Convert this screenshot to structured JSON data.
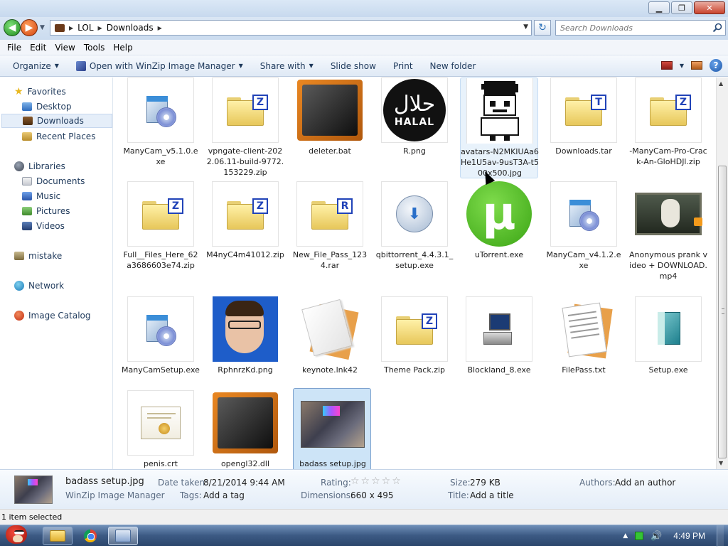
{
  "window": {
    "controls": {
      "minimize": "▁",
      "maximize": "❐",
      "close": "✕"
    }
  },
  "address": {
    "crumbs": [
      "LOL",
      "Downloads"
    ],
    "search_placeholder": "Search Downloads"
  },
  "menu": [
    "File",
    "Edit",
    "View",
    "Tools",
    "Help"
  ],
  "commands": {
    "organize": "Organize",
    "open_with": "Open with WinZip Image Manager",
    "share_with": "Share with",
    "slide_show": "Slide show",
    "print": "Print",
    "new_folder": "New folder",
    "help": "?"
  },
  "nav": {
    "favorites": "Favorites",
    "desktop": "Desktop",
    "downloads": "Downloads",
    "recent": "Recent Places",
    "libraries": "Libraries",
    "documents": "Documents",
    "music": "Music",
    "pictures": "Pictures",
    "videos": "Videos",
    "user": "mistake",
    "network": "Network",
    "catalog": "Image Catalog"
  },
  "files": [
    {
      "name": "ManyCam_v5.1.0.exe",
      "icon": "installer-icon"
    },
    {
      "name": "vpngate-client-2022.06.11-build-9772.153229.zip",
      "icon": "zip-folder-icon",
      "badge": "Z"
    },
    {
      "name": "deleter.bat",
      "icon": "batch-file-icon"
    },
    {
      "name": "R.png",
      "icon": "halal-image-icon",
      "arabic": "حلال",
      "english": "HALAL"
    },
    {
      "name": "avatars-N2MKIUAa6He1U5av-9usT3A-t500x500.jpg",
      "icon": "pixel-avatar-icon"
    },
    {
      "name": "Downloads.tar",
      "icon": "tar-folder-icon",
      "badge": "T"
    },
    {
      "name": "-ManyCam-Pro-Crack-An-GloHDJl.zip",
      "icon": "zip-folder-icon",
      "badge": "Z"
    },
    {
      "name": "Full__Files_Here_62a3686603e74.zip",
      "icon": "zip-folder-icon",
      "badge": "Z"
    },
    {
      "name": "M4nyC4m41012.zip",
      "icon": "zip-folder-icon",
      "badge": "Z"
    },
    {
      "name": "New_File_Pass_1234.rar",
      "icon": "rar-folder-icon",
      "badge": "R"
    },
    {
      "name": "qbittorrent_4.4.3.1_setup.exe",
      "icon": "nsis-installer-icon"
    },
    {
      "name": "uTorrent.exe",
      "icon": "utorrent-icon",
      "glyph": "µ"
    },
    {
      "name": "ManyCam_v4.1.2.exe",
      "icon": "installer-icon"
    },
    {
      "name": "Anonymous prank video + DOWNLOAD.mp4",
      "icon": "video-thumb-icon"
    },
    {
      "name": "ManyCamSetup.exe",
      "icon": "installer-icon"
    },
    {
      "name": "RphnrzKd.png",
      "icon": "face-photo-icon"
    },
    {
      "name": "keynote.lnk42",
      "icon": "document-icon"
    },
    {
      "name": "Theme Pack.zip",
      "icon": "zip-folder-icon",
      "badge": "Z"
    },
    {
      "name": "Blockland_8.exe",
      "icon": "blockland-icon"
    },
    {
      "name": "FilePass.txt",
      "icon": "text-file-icon"
    },
    {
      "name": "Setup.exe",
      "icon": "setup-box-icon"
    },
    {
      "name": "penis.crt",
      "icon": "certificate-icon"
    },
    {
      "name": "opengl32.dll",
      "icon": "dll-file-icon"
    },
    {
      "name": "badass setup.jpg",
      "icon": "photo-thumb-icon",
      "selected": true
    }
  ],
  "details": {
    "filename": "badass setup.jpg",
    "app": "WinZip Image Manager",
    "date_taken_label": "Date taken:",
    "date_taken": "8/21/2014 9:44 AM",
    "tags_label": "Tags:",
    "tags": "Add a tag",
    "rating_label": "Rating:",
    "rating_stars": "☆☆☆☆☆",
    "dimensions_label": "Dimensions:",
    "dimensions": "660 x 495",
    "size_label": "Size:",
    "size": "279 KB",
    "title_label": "Title:",
    "title": "Add a title",
    "authors_label": "Authors:",
    "authors": "Add an author"
  },
  "status": "1 item selected",
  "taskbar": {
    "clock": "4:49 PM"
  }
}
